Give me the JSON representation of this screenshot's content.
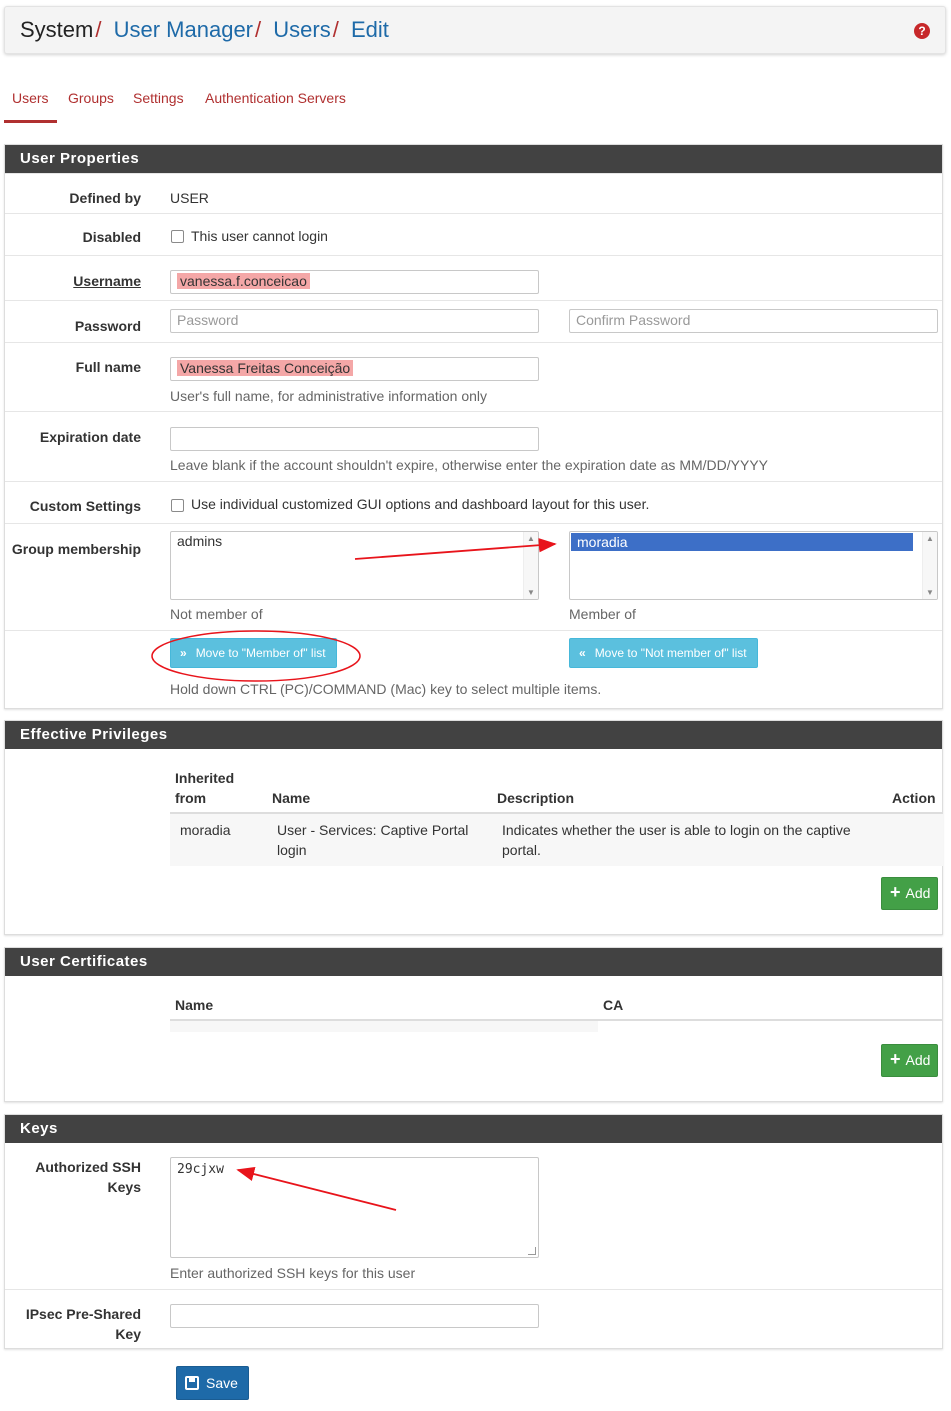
{
  "breadcrumb": {
    "system": "System",
    "sep": "/",
    "user_manager": "User Manager",
    "users": "Users",
    "edit": "Edit"
  },
  "help_icon": "question-circle-icon",
  "tabs": [
    {
      "label": "Users",
      "active": true
    },
    {
      "label": "Groups",
      "active": false
    },
    {
      "label": "Settings",
      "active": false
    },
    {
      "label": "Authentication Servers",
      "active": false
    }
  ],
  "user_properties": {
    "title": "User Properties",
    "defined_by": {
      "label": "Defined by",
      "value": "USER"
    },
    "disabled": {
      "label": "Disabled",
      "text": "This user cannot login",
      "checked": false
    },
    "username": {
      "label": "Username",
      "value": "vanessa.f.conceicao"
    },
    "password": {
      "label": "Password",
      "placeholder": "Password",
      "confirm_placeholder": "Confirm Password"
    },
    "full_name": {
      "label": "Full name",
      "value": "Vanessa Freitas Conceição",
      "help": "User's full name, for administrative information only"
    },
    "expiration": {
      "label": "Expiration date",
      "value": "",
      "help": "Leave blank if the account shouldn't expire, otherwise enter the expiration date as MM/DD/YYYY"
    },
    "custom_settings": {
      "label": "Custom Settings",
      "text": "Use individual customized GUI options and dashboard layout for this user.",
      "checked": false
    },
    "group_membership": {
      "label": "Group membership",
      "not_member_items": [
        "admins"
      ],
      "member_items": [
        "moradia"
      ],
      "not_member_caption": "Not member of",
      "member_caption": "Member of",
      "move_to_member": "Move to \"Member of\" list",
      "move_to_not_member": "Move to \"Not member of\" list",
      "help": "Hold down CTRL (PC)/COMMAND (Mac) key to select multiple items."
    }
  },
  "effective_privileges": {
    "title": "Effective Privileges",
    "columns": {
      "inherited_1": "Inherited",
      "inherited_2": "from",
      "name": "Name",
      "description": "Description",
      "action": "Action"
    },
    "rows": [
      {
        "inherited": "moradia",
        "name_1": "User - Services: Captive Portal",
        "name_2": "login",
        "desc_1": "Indicates whether the user is able to login on the captive",
        "desc_2": "portal."
      }
    ],
    "add": "Add"
  },
  "user_certificates": {
    "title": "User Certificates",
    "columns": {
      "name": "Name",
      "ca": "CA"
    },
    "add": "Add"
  },
  "keys": {
    "title": "Keys",
    "ssh_label_1": "Authorized SSH",
    "ssh_label_2": "Keys",
    "ssh_value": "29cjxw",
    "ssh_help": "Enter authorized SSH keys for this user",
    "ipsec_label_1": "IPsec Pre-Shared",
    "ipsec_label_2": "Key",
    "ipsec_value": ""
  },
  "save": "Save",
  "colors": {
    "brand_red": "#b03030",
    "link_blue": "#1e6aa8",
    "panel_header": "#424242",
    "info": "#5bc0de",
    "success": "#43a047",
    "highlight": "#f4a7a7",
    "annotation": "#e8141b"
  }
}
